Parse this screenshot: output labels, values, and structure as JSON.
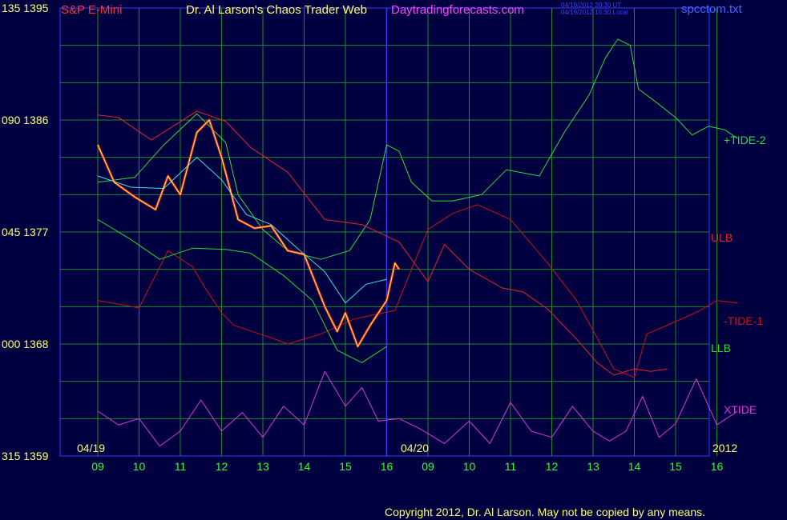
{
  "header": {
    "instrument": "S&P E-Mini",
    "title": "Dr. Al Larson's Chaos Trader Web",
    "site": "Daytradingforecasts.com",
    "stamp_ut": "04/19/2012 20:30 UT",
    "stamp_local": "04/19/2012 15:30 Local",
    "file": "spcctom.txt"
  },
  "y_axis": {
    "rows": [
      {
        "deg": "135",
        "price": "1395"
      },
      {
        "deg": "090",
        "price": "1386"
      },
      {
        "deg": "045",
        "price": "1377"
      },
      {
        "deg": "000",
        "price": "1368"
      },
      {
        "deg": "315",
        "price": "1359"
      }
    ]
  },
  "x_axis": {
    "hours": [
      "09",
      "10",
      "11",
      "12",
      "13",
      "14",
      "15",
      "16",
      "09",
      "10",
      "11",
      "12",
      "13",
      "14",
      "15",
      "16"
    ],
    "dates": [
      "04/19",
      "04/20"
    ],
    "year": "2012"
  },
  "legend": {
    "tide2": "+TIDE-2",
    "ulb": "ULB",
    "tide1": "-TIDE-1",
    "llb": "LLB",
    "xtide": "XTIDE"
  },
  "footer": {
    "copyright": "Copyright 2012, Dr. Al Larson. May not be copied by any means."
  },
  "colors": {
    "background": "#000040",
    "grid": "#1f8a2a",
    "frame": "#3a3aff",
    "axis_text": "#ffff66",
    "hour_text": "#33ff33",
    "tide2": "#33dd33",
    "ulb": "#ee2222",
    "tide1": "#cc1111",
    "llb": "#22dd22",
    "xtide": "#dd33dd",
    "cyan_line": "#44dddd",
    "yellow_line": "#ffff55"
  },
  "chart_data": {
    "type": "line",
    "ylim": [
      1359,
      1395
    ],
    "y_ticks": [
      1359,
      1368,
      1377,
      1386,
      1395
    ],
    "x_ticks": [
      "09",
      "10",
      "11",
      "12",
      "13",
      "14",
      "15",
      "16",
      "09",
      "10",
      "11",
      "12",
      "13",
      "14",
      "15",
      "16"
    ],
    "series": [
      {
        "name": "+TIDE-2",
        "points": [
          [
            0,
            1381
          ],
          [
            0.9,
            1381.4
          ],
          [
            1.6,
            1384
          ],
          [
            2.4,
            1386.5
          ],
          [
            3.1,
            1384.2
          ],
          [
            3.4,
            1380
          ],
          [
            4.0,
            1377.2
          ],
          [
            4.6,
            1375.5
          ],
          [
            5.4,
            1374.8
          ],
          [
            6.1,
            1375.5
          ],
          [
            6.6,
            1378
          ],
          [
            7.0,
            1384
          ],
          [
            7.3,
            1383.5
          ],
          [
            7.6,
            1381
          ],
          [
            8.1,
            1379.5
          ],
          [
            8.6,
            1379.5
          ],
          [
            9.3,
            1380
          ],
          [
            9.9,
            1382
          ],
          [
            10.7,
            1381.5
          ],
          [
            11.3,
            1385
          ],
          [
            11.9,
            1388
          ],
          [
            12.3,
            1391
          ],
          [
            12.6,
            1392.5
          ],
          [
            12.9,
            1392
          ],
          [
            13.1,
            1388.5
          ],
          [
            13.5,
            1387.5
          ],
          [
            14.0,
            1386.2
          ],
          [
            14.4,
            1384.8
          ],
          [
            14.8,
            1385.5
          ],
          [
            15.2,
            1385.2
          ],
          [
            15.5,
            1384.5
          ]
        ]
      },
      {
        "name": "ULB",
        "points": [
          [
            0,
            1386.4
          ],
          [
            0.5,
            1386.2
          ],
          [
            1.3,
            1384.4
          ],
          [
            2.4,
            1386.7
          ],
          [
            3.1,
            1385.9
          ],
          [
            3.7,
            1383.8
          ],
          [
            4.6,
            1381.8
          ],
          [
            5.5,
            1378
          ],
          [
            6.4,
            1377.6
          ],
          [
            7.3,
            1376.2
          ],
          [
            8.0,
            1373
          ],
          [
            8.4,
            1376
          ],
          [
            9.0,
            1374
          ],
          [
            9.8,
            1372.5
          ],
          [
            10.3,
            1372.2
          ],
          [
            10.9,
            1370.8
          ],
          [
            11.6,
            1368.4
          ],
          [
            12.1,
            1366.5
          ],
          [
            12.5,
            1365.5
          ],
          [
            13.0,
            1366
          ],
          [
            13.4,
            1365.8
          ],
          [
            13.8,
            1366
          ]
        ]
      },
      {
        "name": "-TIDE-1",
        "points": [
          [
            0,
            1371.5
          ],
          [
            1.0,
            1370.9
          ],
          [
            1.7,
            1375.5
          ],
          [
            2.3,
            1374.2
          ],
          [
            2.6,
            1372.5
          ],
          [
            3.0,
            1370.5
          ],
          [
            3.3,
            1369.5
          ],
          [
            4.2,
            1368.5
          ],
          [
            4.6,
            1368
          ],
          [
            5.4,
            1368.8
          ],
          [
            6.2,
            1370
          ],
          [
            7.2,
            1370.7
          ],
          [
            7.6,
            1374
          ],
          [
            8.0,
            1377.2
          ],
          [
            8.6,
            1378.5
          ],
          [
            9.2,
            1379.2
          ],
          [
            10.0,
            1378
          ],
          [
            10.9,
            1374.5
          ],
          [
            11.6,
            1371.5
          ],
          [
            12.1,
            1368.5
          ],
          [
            12.5,
            1366
          ],
          [
            13.0,
            1365.3
          ],
          [
            13.3,
            1368.8
          ],
          [
            14.0,
            1369.8
          ],
          [
            14.6,
            1370.7
          ],
          [
            15.0,
            1371.5
          ],
          [
            15.5,
            1371.3
          ]
        ]
      },
      {
        "name": "LLB",
        "points": [
          [
            0,
            1378
          ],
          [
            0.8,
            1376.4
          ],
          [
            1.5,
            1374.8
          ],
          [
            2.3,
            1375.7
          ],
          [
            3.1,
            1375.6
          ],
          [
            3.7,
            1375.3
          ],
          [
            4.5,
            1373.5
          ],
          [
            5.2,
            1371.5
          ],
          [
            5.8,
            1367.5
          ],
          [
            6.4,
            1366.5
          ],
          [
            7.0,
            1367.8
          ]
        ]
      },
      {
        "name": "XTIDE",
        "points": [
          [
            0,
            1362.6
          ],
          [
            0.5,
            1361.5
          ],
          [
            1.0,
            1362
          ],
          [
            1.5,
            1359.8
          ],
          [
            2.0,
            1361
          ],
          [
            2.5,
            1363.5
          ],
          [
            3.0,
            1361
          ],
          [
            3.5,
            1362.5
          ],
          [
            4.0,
            1360.5
          ],
          [
            4.5,
            1363
          ],
          [
            5.0,
            1361.5
          ],
          [
            5.5,
            1365.8
          ],
          [
            6.0,
            1363
          ],
          [
            6.4,
            1364.5
          ],
          [
            6.8,
            1361.8
          ],
          [
            7.3,
            1362
          ],
          [
            7.8,
            1361.2
          ],
          [
            8.4,
            1360
          ],
          [
            9.0,
            1361.8
          ],
          [
            9.5,
            1360
          ],
          [
            10.0,
            1363.3
          ],
          [
            10.5,
            1361
          ],
          [
            11.0,
            1360.5
          ],
          [
            11.5,
            1363
          ],
          [
            12.0,
            1361
          ],
          [
            12.4,
            1360.2
          ],
          [
            12.8,
            1361
          ],
          [
            13.2,
            1363.8
          ],
          [
            13.6,
            1360.5
          ],
          [
            14.0,
            1361.6
          ],
          [
            14.5,
            1365.2
          ],
          [
            15.0,
            1361.5
          ],
          [
            15.5,
            1362.6
          ]
        ]
      },
      {
        "name": "",
        "role": "price",
        "points": [
          [
            0,
            1384
          ],
          [
            0.4,
            1381
          ],
          [
            0.9,
            1379.8
          ],
          [
            1.4,
            1378.8
          ],
          [
            1.7,
            1381.5
          ],
          [
            2.0,
            1380
          ],
          [
            2.4,
            1385
          ],
          [
            2.7,
            1386
          ],
          [
            3.0,
            1383
          ],
          [
            3.4,
            1378
          ],
          [
            3.8,
            1377.3
          ],
          [
            4.2,
            1377.5
          ],
          [
            4.6,
            1375.5
          ],
          [
            5.0,
            1375.2
          ],
          [
            5.5,
            1371
          ],
          [
            5.8,
            1369
          ],
          [
            6.0,
            1370.5
          ],
          [
            6.3,
            1367.8
          ],
          [
            6.6,
            1369.5
          ],
          [
            7.0,
            1371.5
          ],
          [
            7.2,
            1374.5
          ],
          [
            7.3,
            1374
          ]
        ]
      },
      {
        "name": "",
        "role": "cyan_average",
        "points": [
          [
            0,
            1381.5
          ],
          [
            0.8,
            1380.6
          ],
          [
            1.6,
            1380.5
          ],
          [
            2.4,
            1383
          ],
          [
            3.0,
            1381.2
          ],
          [
            3.6,
            1378.4
          ],
          [
            4.2,
            1377.6
          ],
          [
            4.8,
            1375.8
          ],
          [
            5.5,
            1373.8
          ],
          [
            6.0,
            1371.3
          ],
          [
            6.5,
            1372.8
          ],
          [
            7.0,
            1373.2
          ]
        ]
      }
    ]
  }
}
